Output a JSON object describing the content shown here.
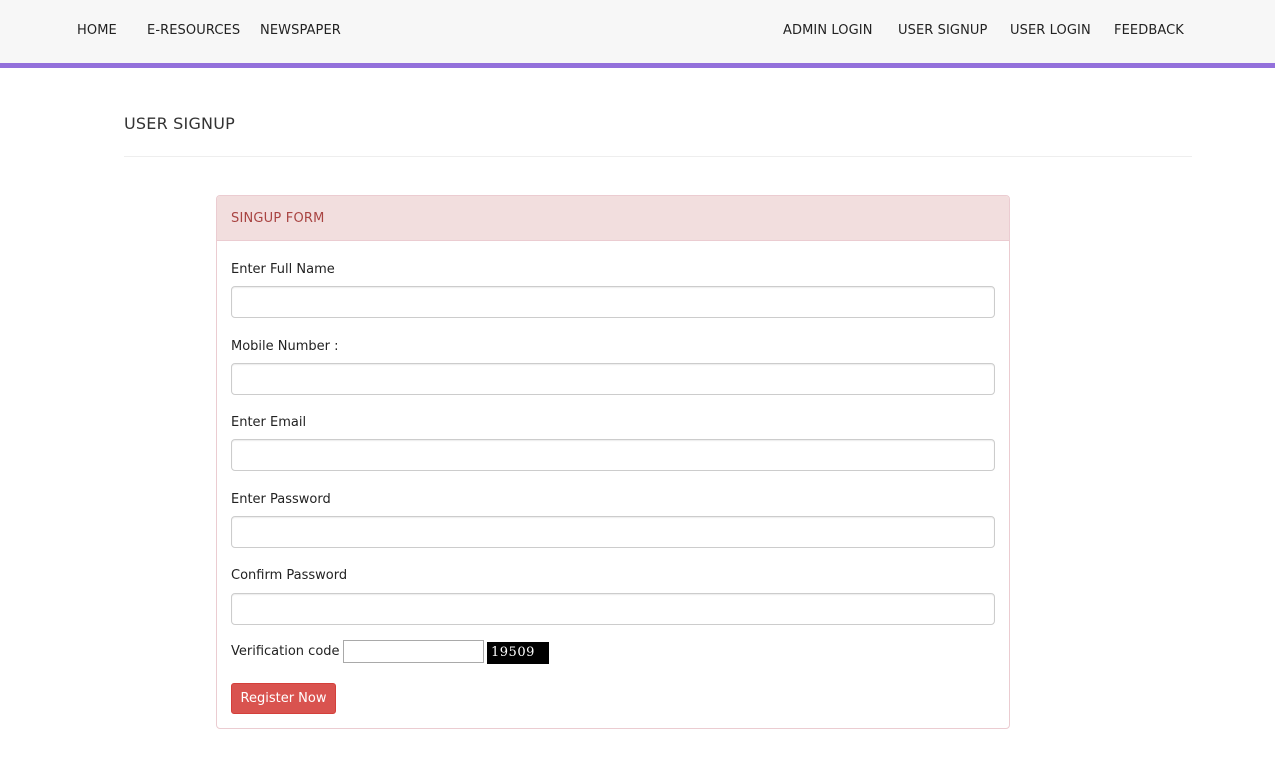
{
  "nav": {
    "left": [
      "HOME",
      "E-RESOURCES",
      "NEWSPAPER"
    ],
    "right": [
      "ADMIN LOGIN",
      "USER SIGNUP",
      "USER LOGIN",
      "FEEDBACK"
    ]
  },
  "page": {
    "title": "USER SIGNUP"
  },
  "form": {
    "heading": "SINGUP FORM",
    "fields": [
      {
        "label": "Enter Full Name",
        "value": "",
        "placeholder": ""
      },
      {
        "label": "Mobile Number :",
        "value": "",
        "placeholder": ""
      },
      {
        "label": "Enter Email",
        "value": "",
        "placeholder": ""
      },
      {
        "label": "Enter Password",
        "value": "",
        "placeholder": ""
      },
      {
        "label": "Confirm Password",
        "value": "",
        "placeholder": ""
      }
    ],
    "verification": {
      "label": "Verification code :",
      "value": "",
      "captcha": "19509"
    },
    "submit_label": "Register Now"
  },
  "colors": {
    "nav_accent": "#9370db",
    "panel_heading_bg": "#f2dede",
    "panel_heading_text": "#a94442",
    "button_bg": "#d9534f"
  }
}
